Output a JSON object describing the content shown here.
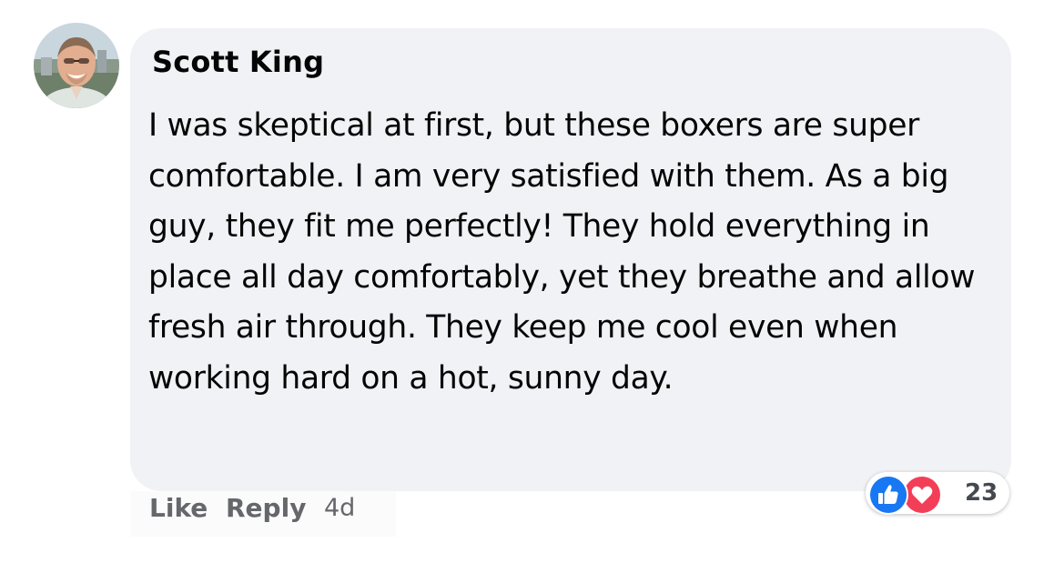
{
  "comment": {
    "author": "Scott King",
    "text": "I was skeptical at first, but these boxers are super comfortable. I am very satisfied with them. As a big guy, they fit me perfectly! They hold everything in place all day comfortably, yet they breathe and allow fresh air through. They keep me cool even when working hard on a hot, sunny day.",
    "bubble_color": "#f0f2f5"
  },
  "reactions": {
    "icons": [
      "like-icon",
      "love-icon"
    ],
    "like_color": "#1877f2",
    "love_color": "#f33e58",
    "count": "23"
  },
  "actions": {
    "like_label": "Like",
    "reply_label": "Reply",
    "timestamp": "4d"
  }
}
